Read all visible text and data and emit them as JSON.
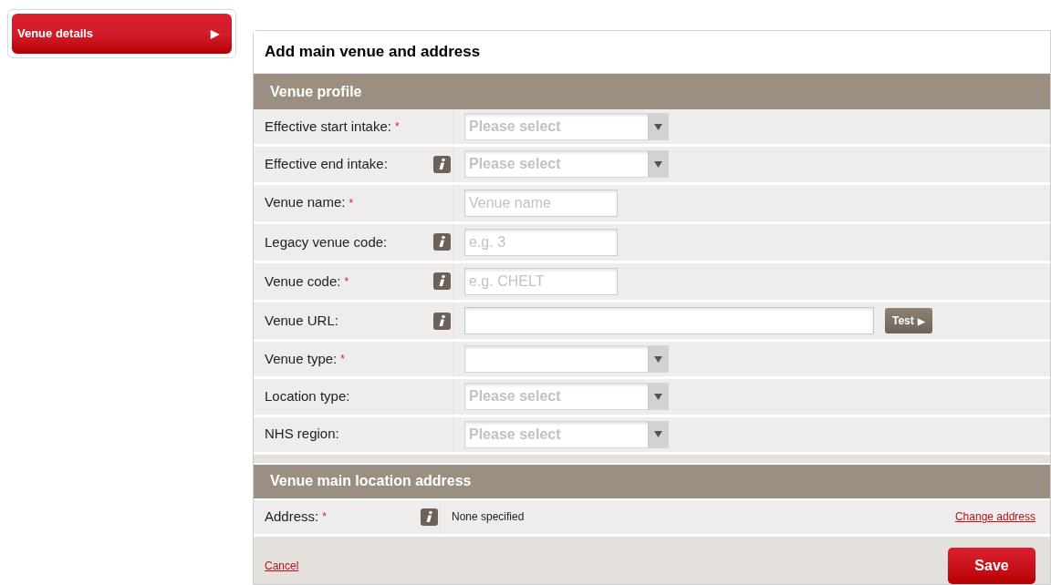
{
  "sidebar": {
    "items": [
      {
        "label": "Venue details",
        "arrow": "▶",
        "selected": true
      }
    ]
  },
  "panel": {
    "title": "Add main venue and address",
    "profile": {
      "heading": "Venue profile",
      "fields": [
        {
          "kind": "select",
          "label": "Effective start intake:",
          "required_mark": "*",
          "info": false,
          "placeholder": "Please select"
        },
        {
          "kind": "select",
          "label": "Effective end intake:",
          "info": true,
          "placeholder": "Please select"
        },
        {
          "kind": "text",
          "label": "Venue name:",
          "required_mark": "*",
          "info": false,
          "placeholder": "Venue name"
        },
        {
          "kind": "text",
          "label": "Legacy venue code:",
          "info": true,
          "placeholder": "e.g. 3"
        },
        {
          "kind": "text",
          "label": "Venue code:",
          "required_mark": "*",
          "info": true,
          "placeholder": "e.g. CHELT"
        },
        {
          "kind": "url",
          "label": "Venue URL:",
          "info": true,
          "button": "Test",
          "button_arrow": "▶"
        },
        {
          "kind": "select",
          "label": "Venue type:",
          "required_mark": "*",
          "info": false
        },
        {
          "kind": "select",
          "label": "Location type:",
          "info": false,
          "placeholder": "Please select"
        },
        {
          "kind": "select",
          "label": "NHS region:",
          "info": false,
          "placeholder": "Please select"
        }
      ]
    },
    "address": {
      "heading": "Venue main location address",
      "label": "Address:",
      "required_mark": "*",
      "info": true,
      "value": "None specified",
      "link": "Change address"
    },
    "footer": {
      "cancel": "Cancel",
      "save": "Save"
    }
  }
}
